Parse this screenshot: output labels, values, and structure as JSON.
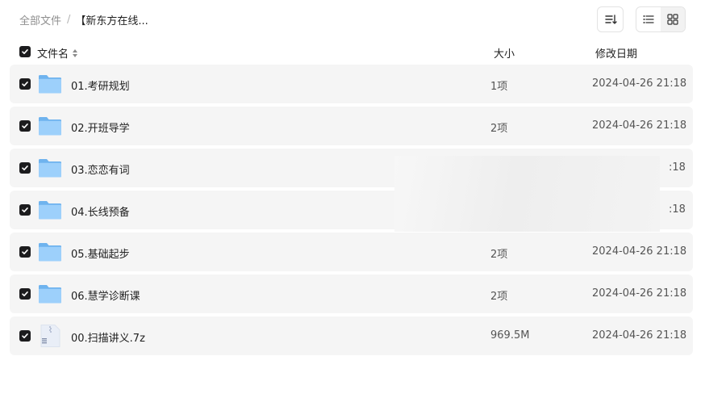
{
  "breadcrumb": {
    "root": "全部文件",
    "separator": "/",
    "current": "【新东方在线..."
  },
  "toolbar": {
    "sort_icon": "sort-list-icon",
    "list_view_icon": "list-view-icon",
    "grid_view_icon": "grid-view-icon",
    "active_view": "list"
  },
  "columns": {
    "name": "文件名",
    "size": "大小",
    "modified": "修改日期"
  },
  "files": [
    {
      "name": "01.考研规划",
      "size": "1项",
      "modified": "2024-04-26 21:18",
      "type": "folder",
      "checked": true
    },
    {
      "name": "02.开班导学",
      "size": "2项",
      "modified": "2024-04-26 21:18",
      "type": "folder",
      "checked": true
    },
    {
      "name": "03.恋恋有词",
      "size": "",
      "modified": ":18",
      "type": "folder",
      "checked": true
    },
    {
      "name": "04.长线预备",
      "size": "",
      "modified": ":18",
      "type": "folder",
      "checked": true
    },
    {
      "name": "05.基础起步",
      "size": "2项",
      "modified": "2024-04-26 21:18",
      "type": "folder",
      "checked": true
    },
    {
      "name": "06.慧学诊断课",
      "size": "2项",
      "modified": "2024-04-26 21:18",
      "type": "folder",
      "checked": true
    },
    {
      "name": "00.扫描讲义.7z",
      "size": "969.5M",
      "modified": "2024-04-26 21:18",
      "type": "archive",
      "checked": true
    }
  ],
  "colors": {
    "row_bg": "#f5f5f5",
    "folder": "#8cc4f5",
    "checkbox": "#1c1c1e"
  }
}
